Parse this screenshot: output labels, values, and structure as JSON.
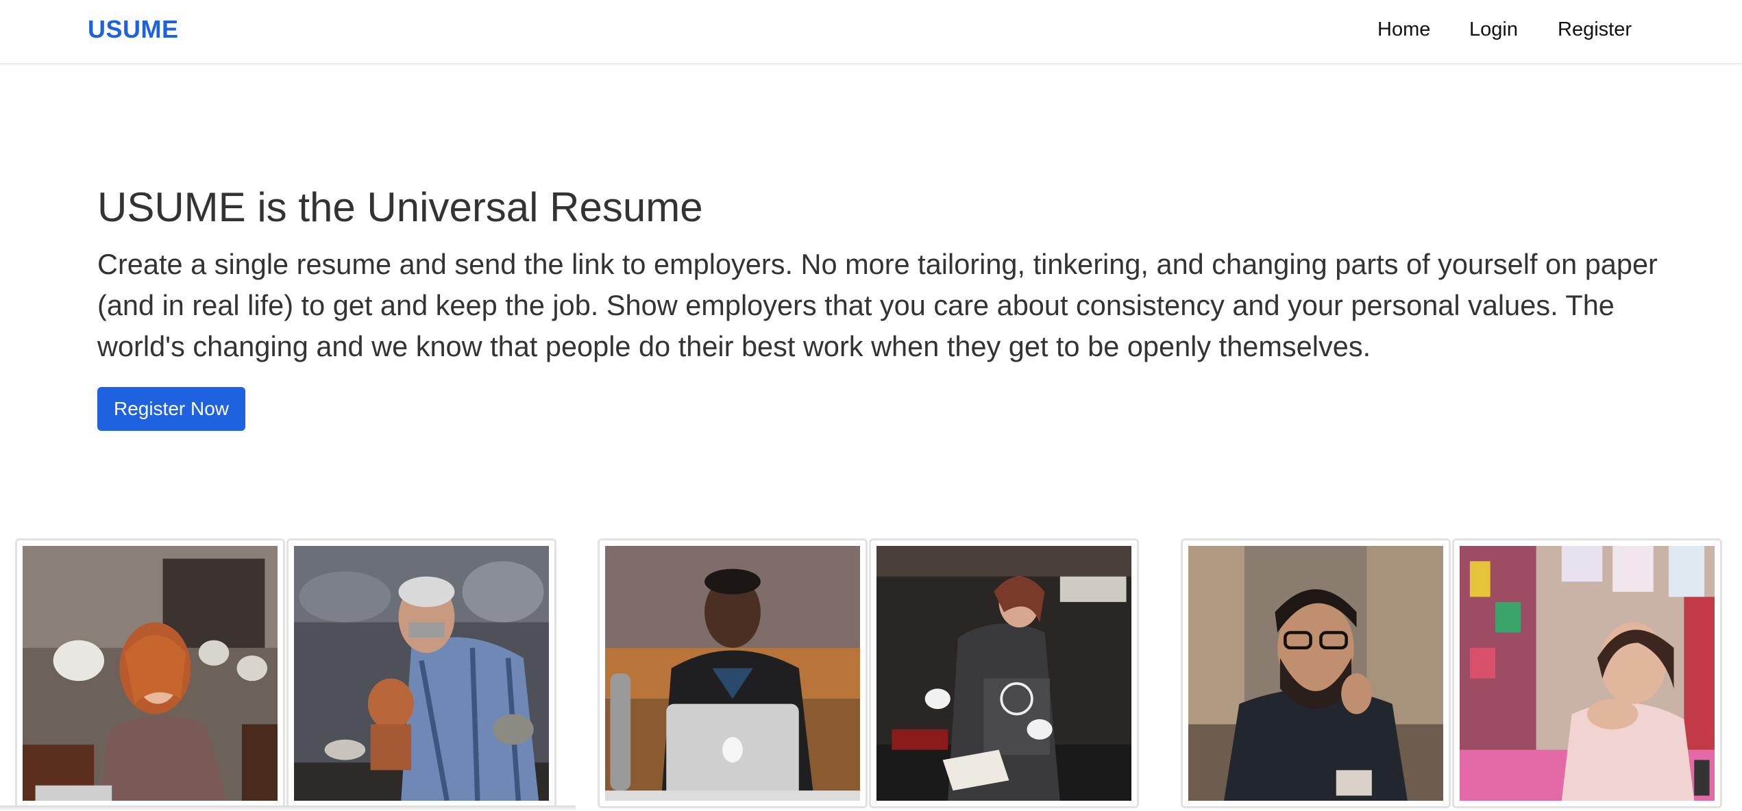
{
  "navbar": {
    "brand": "USUME",
    "links": [
      {
        "label": "Home"
      },
      {
        "label": "Login"
      },
      {
        "label": "Register"
      }
    ]
  },
  "hero": {
    "title": "USUME is the Universal Resume",
    "description": "Create a single resume and send the link to employers. No more tailoring, tinkering, and changing parts of yourself on paper (and in real life) to get and keep the job. Show employers that you care about consistency and your personal values. The world's changing and we know that people do their best work when they get to be openly themselves.",
    "cta_label": "Register Now"
  },
  "colors": {
    "accent": "#1f62e0",
    "text": "#333333"
  },
  "gallery": [
    {
      "subject": "woman-with-laptop-photo"
    },
    {
      "subject": "coppersmith-photo"
    },
    {
      "subject": "man-with-laptop-photo"
    },
    {
      "subject": "chef-in-apron-photo"
    },
    {
      "subject": "man-with-glasses-photo"
    },
    {
      "subject": "smiling-woman-photo"
    }
  ]
}
